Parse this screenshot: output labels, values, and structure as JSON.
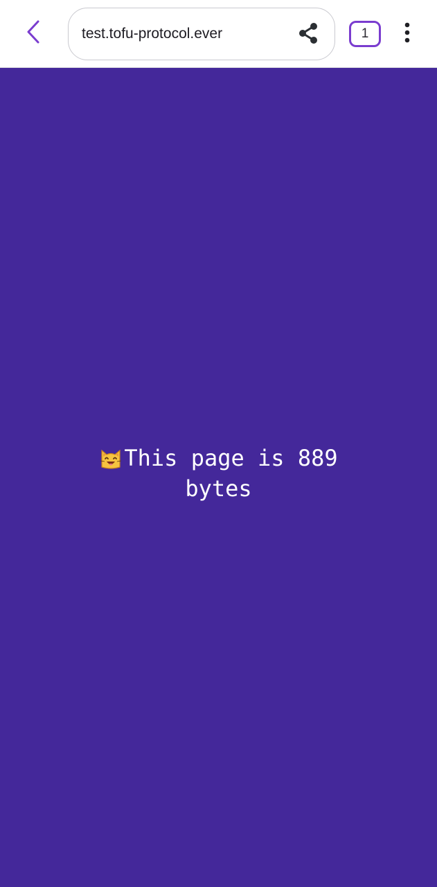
{
  "browser": {
    "url": "test.tofu-protocol.ever",
    "tab_count": "1",
    "accent_color": "#7a3ccf",
    "icons": {
      "back": "chevron-left-icon",
      "share": "share-icon",
      "menu": "more-vertical-icon"
    }
  },
  "page": {
    "background_color": "#44289a",
    "text_color": "#ffffff",
    "emoji": "cat-smiling-face-emoji",
    "message": "This page is 889 bytes"
  }
}
